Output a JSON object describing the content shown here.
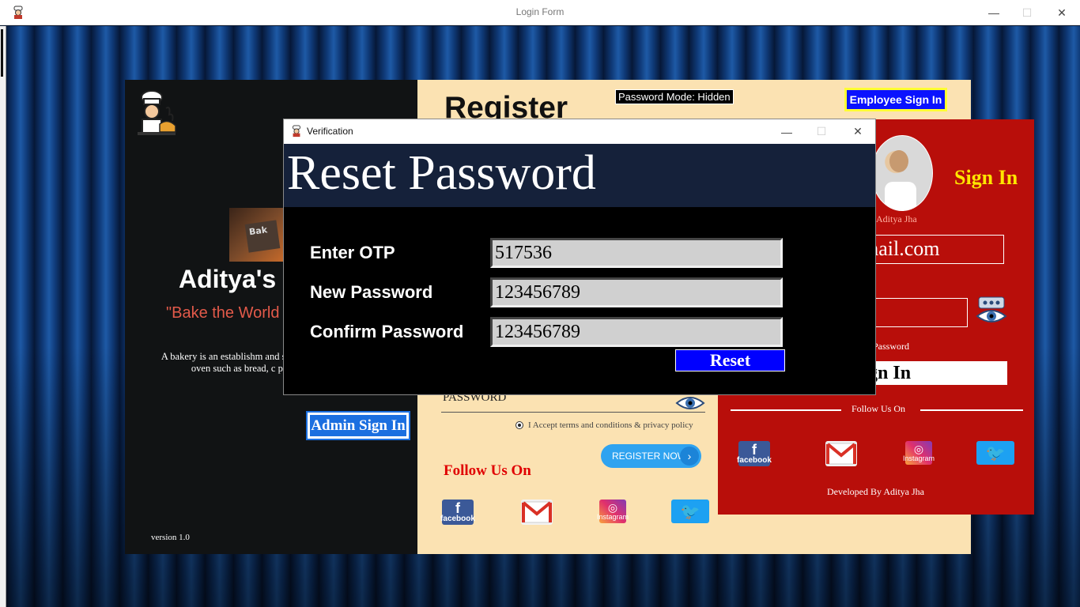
{
  "main_window": {
    "title": "Login Form",
    "minimize": "—",
    "maximize": "☐",
    "close": "✕"
  },
  "left_panel": {
    "brand_name": "Aditya's",
    "tagline": "\"Bake the World",
    "description": "A bakery is an establishm and sells flour-based fo oven such as bread, c pastries, and",
    "admin_button": "Admin Sign In",
    "version": "version 1.0",
    "image_text": "Bak"
  },
  "register_panel": {
    "title": "Register",
    "password_mode": "Password Mode: Hidden",
    "employee_button": "Employee Sign In",
    "password_label": "PASSWORD",
    "terms_text": "I Accept terms and conditions & privacy policy",
    "register_button": "REGISTER NOW",
    "follow_label": "Follow Us On"
  },
  "signin_panel": {
    "title": "Sign In",
    "avatar_name": "Aditya Jha",
    "email_partial": "mail.com",
    "forgot_partial": "Password",
    "button_partial": "gn In",
    "follow_label": "Follow Us On",
    "developer": "Developed By Aditya Jha"
  },
  "social": {
    "facebook_label": "facebook",
    "instagram_label": "Instagram"
  },
  "dialog": {
    "window_title": "Verification",
    "heading": "Reset Password",
    "otp_label": "Enter OTP",
    "otp_value": "517536",
    "new_password_label": "New Password",
    "new_password_value": "123456789",
    "confirm_password_label": "Confirm Password",
    "confirm_password_value": "123456789",
    "reset_button": "Reset"
  },
  "colors": {
    "dialog_header": "#15213a",
    "reset_button": "#0000ff",
    "signin_panel": "#b80e0a",
    "register_panel": "#fbe2b2",
    "signin_title": "#ffe600"
  }
}
